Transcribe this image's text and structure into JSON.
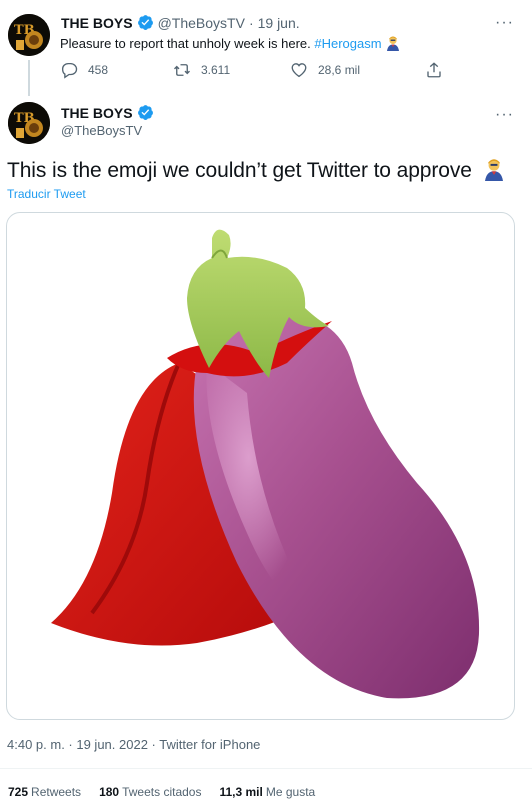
{
  "reply_context": {
    "author_name": "THE BOYS",
    "author_handle": "@TheBoysTV",
    "separator": "·",
    "date": "19 jun.",
    "text_main": "Pleasure to report that unholy week is here. ",
    "hashtag": "#Herogasm",
    "actions": {
      "replies": "458",
      "retweets": "3.611",
      "likes": "28,6 mil"
    }
  },
  "tweet": {
    "author_name": "THE BOYS",
    "author_handle": "@TheBoysTV",
    "text": "This is the emoji we couldn’t get Twitter to approve",
    "translate_link": "Traducir Tweet",
    "timestamp": "4:40 p. m. · 19 jun. 2022 · Twitter for iPhone",
    "stats": {
      "retweets_count": "725",
      "retweets_label": "Retweets",
      "quotes_count": "180",
      "quotes_label": "Tweets citados",
      "likes_count": "11,3 mil",
      "likes_label": "Me gusta"
    }
  },
  "colors": {
    "accent": "#1d9bf0",
    "muted_text": "#536471",
    "eggplant": "#a7508f",
    "cape_red": "#d40f0f",
    "stem_green": "#a6cc58"
  },
  "icons": [
    "avatar-logo-icon",
    "verified-badge-icon",
    "more-options-icon",
    "reply-icon",
    "retweet-icon",
    "like-icon",
    "share-icon",
    "superhero-emoji-icon"
  ]
}
